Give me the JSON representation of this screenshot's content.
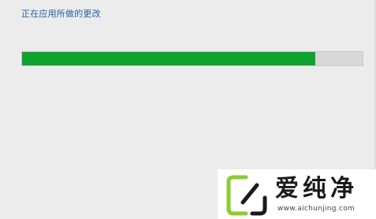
{
  "dialog": {
    "status_text": "正在应用所做的更改",
    "progress_fraction": 0.86
  },
  "watermark": {
    "brand_text": "爱纯净",
    "url_text": "www.aichunjing.com",
    "logo_icon": "slash-bracket-logo-icon"
  },
  "colors": {
    "status_text": "#1f5fa8",
    "progress_fill": "#0ea32f",
    "progress_track": "#d8d8d8",
    "logo_green": "#8ccb2f",
    "logo_dark": "#1a1a1a",
    "url_text": "#444444"
  }
}
